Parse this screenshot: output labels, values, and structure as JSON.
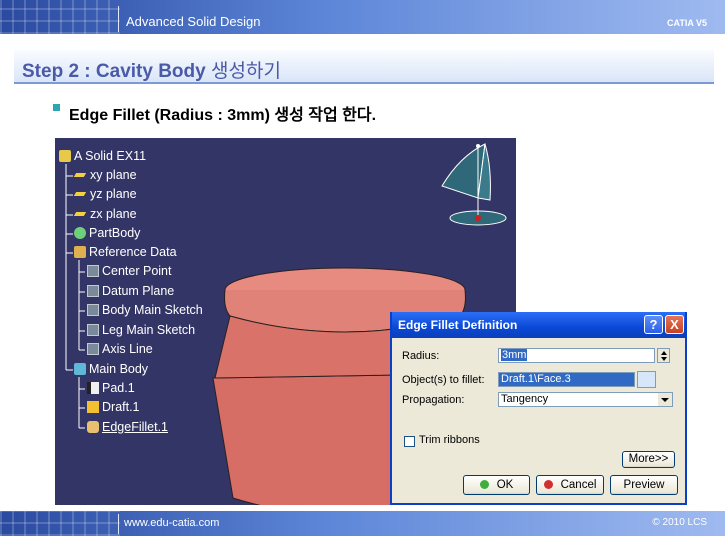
{
  "header": {
    "title": "Advanced Solid Design",
    "right_label": "CATIA V5"
  },
  "step": {
    "title": "Step 2 : Cavity Body",
    "title_kr": "생성하기"
  },
  "bullet": {
    "text": "Edge Fillet (Radius : 3mm)",
    "text_kr": "생성 작업 한다."
  },
  "tree": {
    "root": "A Solid EX11",
    "items": [
      {
        "label": "xy plane",
        "icon": "plane-icon"
      },
      {
        "label": "yz plane",
        "icon": "plane-icon"
      },
      {
        "label": "zx plane",
        "icon": "plane-icon"
      },
      {
        "label": "PartBody",
        "icon": "partbody-icon"
      },
      {
        "label": "Reference Data",
        "icon": "body-icon"
      },
      {
        "label": "Center Point",
        "icon": "point-icon"
      },
      {
        "label": "Datum Plane",
        "icon": "datum-plane-icon"
      },
      {
        "label": "Body Main Sketch",
        "icon": "sketch-icon"
      },
      {
        "label": "Leg Main Sketch",
        "icon": "sketch-icon"
      },
      {
        "label": "Axis Line",
        "icon": "line-icon"
      },
      {
        "label": "Main Body",
        "icon": "body-icon"
      },
      {
        "label": "Pad.1",
        "icon": "pad-icon"
      },
      {
        "label": "Draft.1",
        "icon": "draft-icon"
      },
      {
        "label": "EdgeFillet.1",
        "icon": "edge-fillet-icon"
      }
    ]
  },
  "dialog": {
    "title": "Edge Fillet Definition",
    "help_label": "?",
    "close_label": "X",
    "radius_label": "Radius:",
    "radius_value": "3mm",
    "objects_label": "Object(s) to fillet:",
    "objects_value": "Draft.1\\Face.3",
    "propagation_label": "Propagation:",
    "propagation_value": "Tangency",
    "trim_label": "Trim ribbons",
    "trim_checked": false,
    "more_label": "More>>",
    "ok_label": "OK",
    "cancel_label": "Cancel",
    "preview_label": "Preview"
  },
  "footer": {
    "left": "www.edu-catia.com",
    "right": "© 2010 LCS"
  },
  "colors": {
    "viewport_bg": "#333566",
    "model_fill": "#e07c72",
    "title_blue": "#4b5aa7",
    "dialog_title": "#0a49d6"
  }
}
